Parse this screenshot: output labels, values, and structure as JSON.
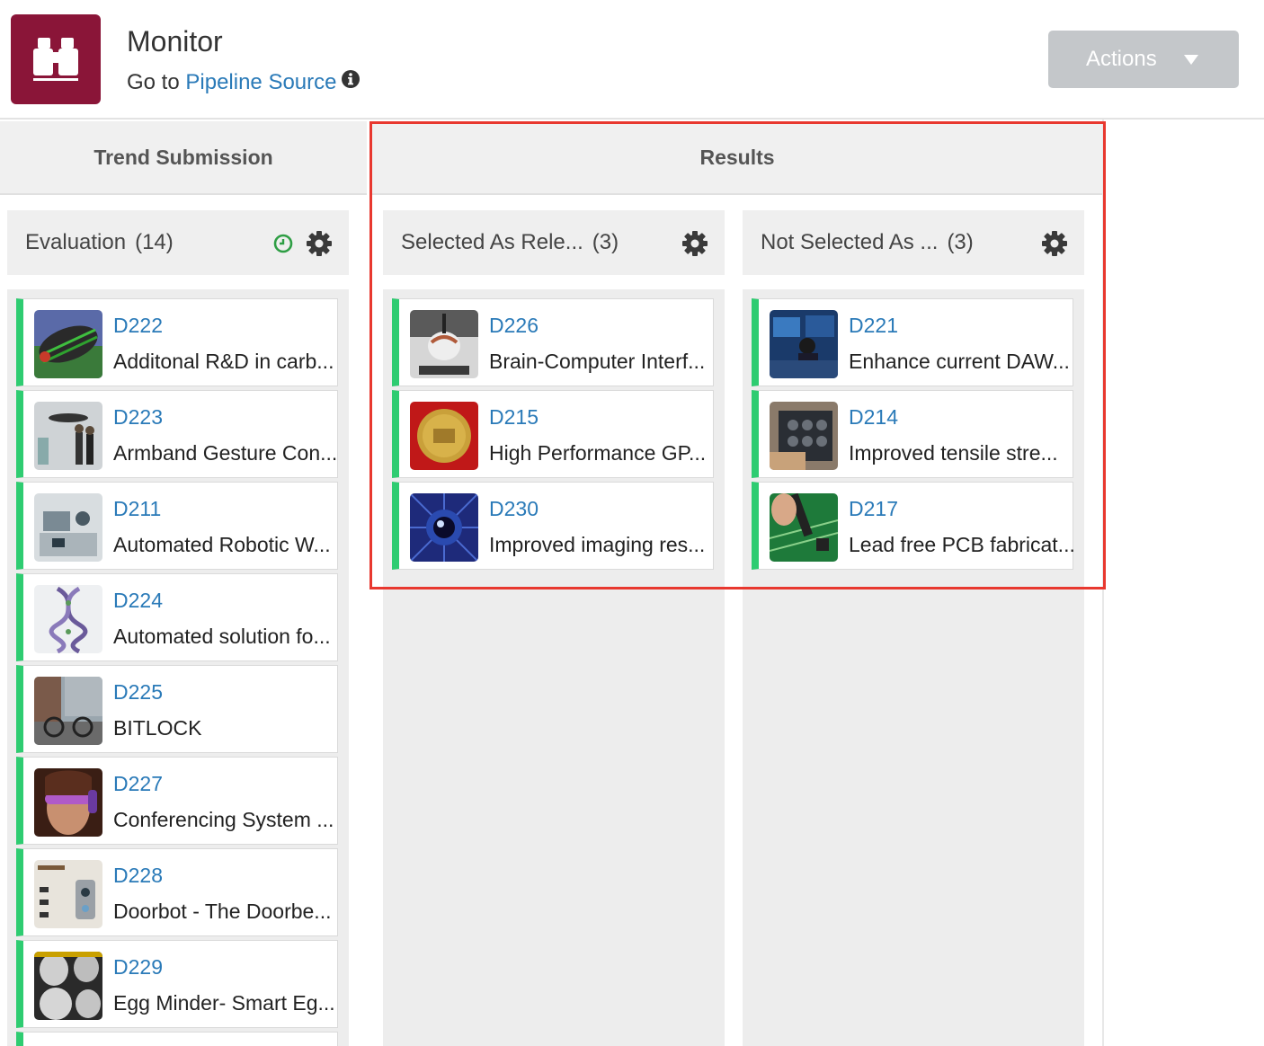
{
  "header": {
    "title": "Monitor",
    "goto_prefix": "Go to",
    "goto_link": "Pipeline Source",
    "actions_label": "Actions"
  },
  "groups": {
    "trend": "Trend Submission",
    "results": "Results"
  },
  "columns": [
    {
      "title": "Evaluation",
      "count": "(14)",
      "cards": [
        {
          "code": "D222",
          "name": "Additonal R&D in carb..."
        },
        {
          "code": "D223",
          "name": "Armband Gesture Con..."
        },
        {
          "code": "D211",
          "name": "Automated Robotic W..."
        },
        {
          "code": "D224",
          "name": "Automated solution fo..."
        },
        {
          "code": "D225",
          "name": "BITLOCK"
        },
        {
          "code": "D227",
          "name": "Conferencing System ..."
        },
        {
          "code": "D228",
          "name": "Doorbot - The Doorbe..."
        },
        {
          "code": "D229",
          "name": "Egg Minder- Smart Eg..."
        }
      ]
    },
    {
      "title": "Selected As Rele...",
      "count": "(3)",
      "cards": [
        {
          "code": "D226",
          "name": "Brain-Computer Interf..."
        },
        {
          "code": "D215",
          "name": "High Performance GP..."
        },
        {
          "code": "D230",
          "name": "Improved imaging res..."
        }
      ]
    },
    {
      "title": "Not Selected As ...",
      "count": "(3)",
      "cards": [
        {
          "code": "D221",
          "name": "Enhance current DAW..."
        },
        {
          "code": "D214",
          "name": "Improved tensile stre..."
        },
        {
          "code": "D217",
          "name": "Lead free PCB fabricat..."
        }
      ]
    }
  ],
  "colors": {
    "brand": "#8a1538",
    "link": "#2a7ab8",
    "card_accent": "#2ecc71",
    "highlight": "#e8382f",
    "clock": "#2e9e44"
  }
}
